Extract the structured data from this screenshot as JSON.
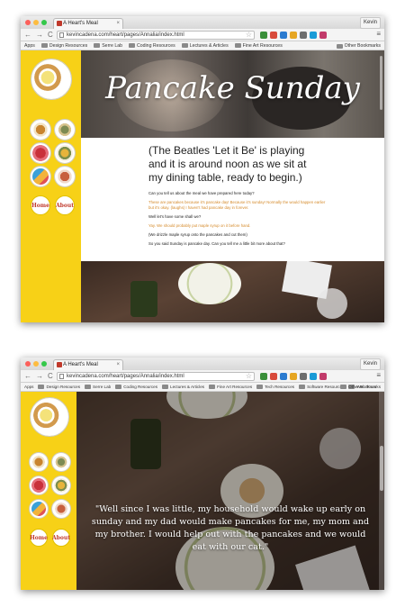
{
  "browser": {
    "tab_title": "A Heart's Meal",
    "tab_close": "×",
    "user_name": "Kevin",
    "url": "kevincadena.com/heart/pages/Annalia/index.html",
    "nav_glyphs": [
      "←",
      "→",
      "C"
    ],
    "menu_glyph": "≡",
    "star_glyph": "☆",
    "bookmarks_top": [
      "Apps",
      "Design Resources",
      "Serre Lab",
      "Coding Resources",
      "Lectures & Articles",
      "Fine Art Resources"
    ],
    "other_bookmarks": "Other Bookmarks",
    "bookmarks_bottom": [
      "Apps",
      "Design Resources",
      "Serre Lab",
      "Coding Resources",
      "Lectures & Articles",
      "Fine Art Resources",
      "Tech Resources",
      "Software Resources",
      "Web Tours"
    ],
    "other_bookmarks_bottom": "Other Bookmarks"
  },
  "sidebar": {
    "home_label": "Home",
    "about_label": "About"
  },
  "hero": {
    "title": "Pancake Sunday"
  },
  "content": {
    "lead": "(The Beatles 'Let it Be' is playing and it is around noon as we sit at my dining table, ready to begin.)",
    "qa": [
      {
        "text": "Can you tell us about the meal we have prepared here today?",
        "color": "#222222"
      },
      {
        "text": "These are pancakes because it's pancake day! Because it's sunday! Normally the would happen earlier but it's okay. (laughs) I haven't had pancake day in forever.",
        "color": "#d58a2a"
      },
      {
        "text": "Well let's have some shall we?",
        "color": "#222222"
      },
      {
        "text": "Yay. We should probably put maple syrup on it before hand.",
        "color": "#d58a2a"
      },
      {
        "text": "(We drizzle maple syrup onto the pancakes and cut them)",
        "color": "#222222"
      },
      {
        "text": "So you said Sunday is pancake day. Can you tell me a little bit more about that?",
        "color": "#222222"
      }
    ]
  },
  "quote": {
    "text": "\"Well since I was little, my household would wake up early on sunday and my dad would make pancakes for me, my mom and my brother. I would help out with the pancakes and we would eat with our cat.\""
  },
  "colors": {
    "sidebar": "#f7d117",
    "accent_orange": "#d58a2a",
    "nav_text": "#c0392b"
  },
  "icons": [
    "traffic-lights",
    "back-arrow-icon",
    "forward-arrow-icon",
    "reload-icon",
    "page-icon",
    "star-icon",
    "folder-icon",
    "menu-icon"
  ]
}
